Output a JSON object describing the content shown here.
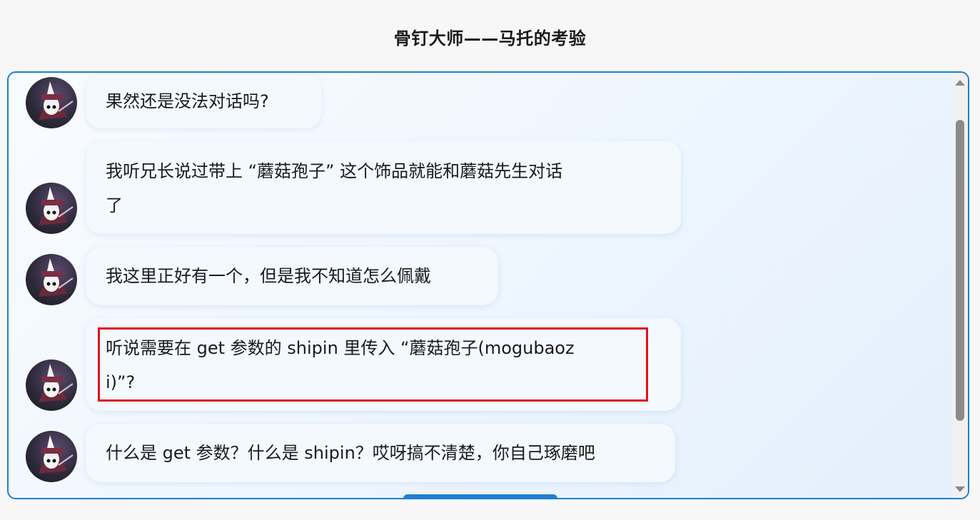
{
  "page": {
    "title": "骨钉大师——马托的考验"
  },
  "colors": {
    "accent": "#1e7fd4",
    "highlight_border": "#e0131a",
    "bubble_bg": "#f4f8ff"
  },
  "messages": [
    {
      "lines": [
        "果然还是没法对话吗?"
      ]
    },
    {
      "lines": [
        "我听兄长说过带上 “蘑菇孢子” 这个饰品就能和蘑菇先生对话",
        "了"
      ]
    },
    {
      "lines": [
        "我这里正好有一个，但是我不知道怎么佩戴"
      ]
    },
    {
      "lines": [
        "听说需要在 get 参数的 shipin 里传入 “蘑菇孢子(mogubaoz",
        "i)”?"
      ],
      "highlighted": true
    },
    {
      "lines": [
        "什么是 get 参数？什么是 shipin？哎呀搞不清楚，你自己琢磨吧"
      ]
    }
  ],
  "icons": {
    "avatar": "knight-avatar-icon",
    "scroll_up": "scroll-up-arrow-icon",
    "scroll_down": "scroll-down-arrow-icon"
  }
}
